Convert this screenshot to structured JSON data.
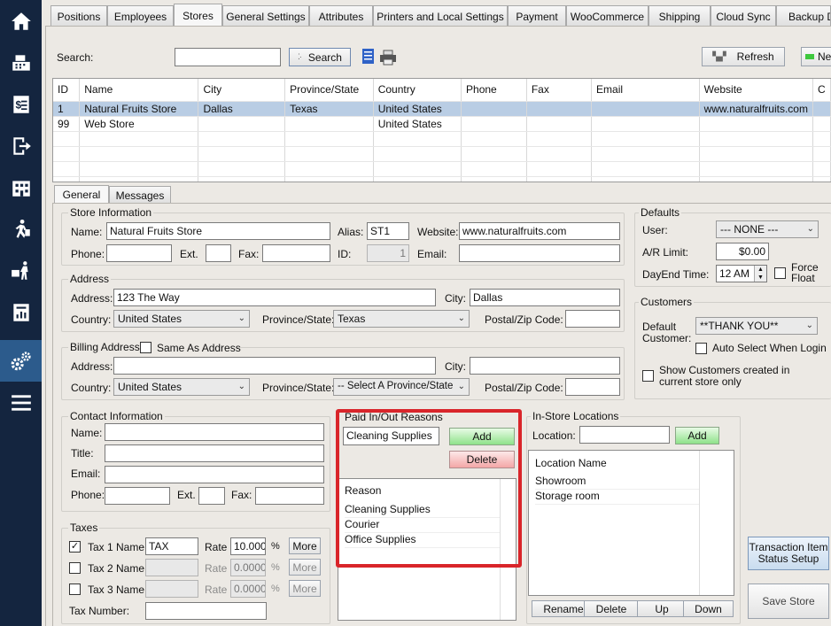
{
  "sidebar": {
    "items": [
      {
        "icon": "home-icon"
      },
      {
        "icon": "cash-register-icon"
      },
      {
        "icon": "receipt-icon"
      },
      {
        "icon": "logout-icon"
      },
      {
        "icon": "building-icon"
      },
      {
        "icon": "walking-person-icon"
      },
      {
        "icon": "delivery-icon"
      },
      {
        "icon": "report-icon"
      },
      {
        "icon": "settings-gears-icon"
      },
      {
        "icon": "menu-icon"
      }
    ],
    "active_index": 8,
    "colors": {
      "background": "#14253f",
      "active": "#2c5b8c",
      "icon": "#ffffff"
    }
  },
  "tabs": [
    "Positions",
    "Employees",
    "Stores",
    "General Settings",
    "Attributes",
    "Printers and Local Settings",
    "Payment",
    "WooCommerce",
    "Shipping",
    "Cloud Sync",
    "Backup D"
  ],
  "active_tab": "Stores",
  "toolbar": {
    "search_label": "Search:",
    "search_value": "",
    "search_button": "Search",
    "refresh_button": "Refresh",
    "new_button": "Ne"
  },
  "stores_table": {
    "columns": [
      "ID",
      "Name",
      "City",
      "Province/State",
      "Country",
      "Phone",
      "Fax",
      "Email",
      "Website",
      "C"
    ],
    "rows": [
      [
        "1",
        "Natural Fruits Store",
        "Dallas",
        "Texas",
        "United States",
        "",
        "",
        "",
        "www.naturalfruits.com",
        ""
      ],
      [
        "99",
        "Web Store",
        "",
        "",
        "United States",
        "",
        "",
        "",
        "",
        ""
      ]
    ],
    "selected_row": 0
  },
  "sub_tabs": [
    "General",
    "Messages"
  ],
  "active_sub_tab": "General",
  "store_info": {
    "title": "Store Information",
    "name_label": "Name:",
    "name_value": "Natural Fruits Store",
    "alias_label": "Alias:",
    "alias_value": "ST1",
    "website_label": "Website:",
    "website_value": "www.naturalfruits.com",
    "phone_label": "Phone:",
    "phone_value": "",
    "ext_label": "Ext.",
    "ext_value": "",
    "fax_label": "Fax:",
    "fax_value": "",
    "id_label": "ID:",
    "id_value": "1",
    "email_label": "Email:",
    "email_value": ""
  },
  "address": {
    "title": "Address",
    "address_label": "Address:",
    "address_value": "123 The Way",
    "city_label": "City:",
    "city_value": "Dallas",
    "country_label": "Country:",
    "country_value": "United States",
    "province_label": "Province/State:",
    "province_value": "Texas",
    "postal_label": "Postal/Zip Code:",
    "postal_value": ""
  },
  "billing": {
    "title": "Billing Address -",
    "same_as_label": "Same As Address",
    "same_as_checked": false,
    "address_label": "Address:",
    "address_value": "",
    "city_label": "City:",
    "city_value": "",
    "country_label": "Country:",
    "country_value": "United States",
    "province_label": "Province/State:",
    "province_value": "-- Select A Province/State --",
    "postal_label": "Postal/Zip Code:",
    "postal_value": ""
  },
  "defaults": {
    "title": "Defaults",
    "user_label": "User:",
    "user_value": "--- NONE ---",
    "ar_limit_label": "A/R Limit:",
    "ar_limit_value": "$0.00",
    "dayend_label": "DayEnd Time:",
    "dayend_value": "12 AM",
    "force_float_label": "Force Float",
    "force_float_checked": false
  },
  "customers": {
    "title": "Customers",
    "default_customer_label": "Default Customer:",
    "default_customer_value": "**THANK YOU**",
    "auto_select_label": "Auto Select When Login",
    "auto_select_checked": false,
    "show_customers_label": "Show Customers created in current store only",
    "show_customers_checked": false
  },
  "contact": {
    "title": "Contact Information",
    "name_label": "Name:",
    "title_label": "Title:",
    "email_label": "Email:",
    "phone_label": "Phone:",
    "ext_label": "Ext.",
    "fax_label": "Fax:"
  },
  "taxes": {
    "title": "Taxes",
    "rows": [
      {
        "checked": true,
        "label": "Tax 1 Name",
        "name": "TAX",
        "rate_label": "Rate",
        "rate": "10.000",
        "unit": "%",
        "more": "More",
        "enabled": true
      },
      {
        "checked": false,
        "label": "Tax 2 Name",
        "name": "",
        "rate_label": "Rate",
        "rate": "0.0000",
        "unit": "%",
        "more": "More",
        "enabled": false
      },
      {
        "checked": false,
        "label": "Tax 3 Name",
        "name": "",
        "rate_label": "Rate",
        "rate": "0.0000",
        "unit": "%",
        "more": "More",
        "enabled": false
      }
    ],
    "tax_number_label": "Tax Number:",
    "tax_number_value": ""
  },
  "paid_reasons": {
    "title": "Paid In/Out Reasons",
    "input_value": "Cleaning Supplies",
    "add_button": "Add",
    "delete_button": "Delete",
    "column": "Reason",
    "items": [
      "Cleaning Supplies",
      "Courier",
      "Office Supplies"
    ],
    "highlight_color": "#d9252a"
  },
  "locations": {
    "title": "In-Store Locations",
    "location_label": "Location:",
    "location_value": "",
    "add_button": "Add",
    "column": "Location Name",
    "items": [
      "Showroom",
      "Storage room"
    ],
    "rename_button": "Rename",
    "delete_button": "Delete",
    "up_button": "Up",
    "down_button": "Down"
  },
  "transaction_button": "Transaction Item Status Setup",
  "save_button": "Save Store"
}
